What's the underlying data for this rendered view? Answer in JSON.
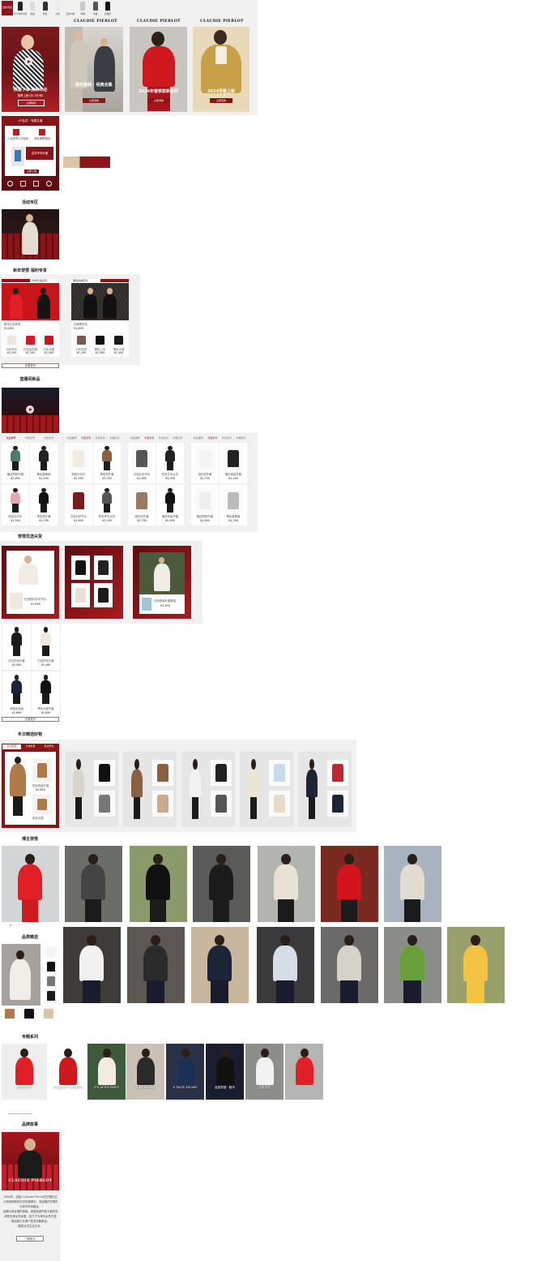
{
  "top_nav": {
    "items": [
      {
        "label": "活动专区",
        "active": true
      },
      {
        "label": "CP×传承大赛"
      },
      {
        "label": "新品"
      },
      {
        "label": "外套"
      },
      {
        "label": "大衣"
      },
      {
        "label": "卫衣/T恤"
      },
      {
        "label": "羊绒"
      },
      {
        "label": "半裙"
      },
      {
        "label": "直播间"
      }
    ]
  },
  "brand": {
    "logo": "CLAUDIE PIERLOT"
  },
  "hero_banners": [
    {
      "title": "快速下单 抢新年必",
      "subtitle": "春季上新1折 2件9折",
      "cta": "立即购买"
    },
    {
      "title": "新年焕新 · 经典合集",
      "cta": "立即选购"
    },
    {
      "title": "2024年春季款新系列",
      "cta": "立即选购"
    },
    {
      "title": "2024早春上新",
      "cta": "立即选购"
    }
  ],
  "member_card": {
    "header": "CP会员 · 专属礼遇",
    "perk1": "入会即享1次免邮",
    "perk2": "消费满额赠品",
    "perk3": "会员专享价格",
    "join": "立即入会",
    "icons": [
      "积分",
      "优惠",
      "礼品",
      "客服"
    ]
  },
  "sections": {
    "activity": "活动专区",
    "new_year": "新年穿搭 福利专享",
    "live": "直播间新品",
    "curated": "穿搭优选尖货",
    "knit": "冬日精选好物",
    "blogger": "博主穿搭",
    "offline": "品类精选",
    "collections": "专题系列",
    "story": "品牌故事"
  },
  "ny_cards": [
    {
      "label": "新年红色系列",
      "top": "新年红色穿搭",
      "price": "¥1,890"
    },
    {
      "label": "黑色丝绒系列",
      "top": "优雅黑色系",
      "price": "¥1,890"
    }
  ],
  "ny_products": [
    {
      "name": "针织开衫",
      "price": "¥1,290"
    },
    {
      "name": "红色连衣裙",
      "price": "¥2,190"
    },
    {
      "name": "红色半裙",
      "price": "¥1,490"
    },
    {
      "name": "针织毛衣",
      "price": "¥1,290"
    },
    {
      "name": "黑色上衣",
      "price": "¥1,590"
    },
    {
      "name": "黑色半裙",
      "price": "¥1,390"
    }
  ],
  "ny_more": "查看更多",
  "tab_groups": [
    {
      "tabs": [
        "新品推荐",
        "外套系列",
        "针织系列"
      ]
    },
    {
      "tabs": [
        "新品推荐",
        "外套系列",
        "针织系列",
        "半裙系列"
      ]
    },
    {
      "tabs": [
        "新品推荐",
        "外套系列",
        "针织系列",
        "半裙系列"
      ]
    },
    {
      "tabs": [
        "新品推荐",
        "外套系列",
        "针织系列",
        "半裙系列"
      ]
    }
  ],
  "grid_products": [
    {
      "name": "格纹短款外套",
      "price": "¥2,690"
    },
    {
      "name": "黑色直筒裤",
      "price": "¥1,290"
    },
    {
      "name": "粉色针织衫",
      "price": "¥1,590"
    },
    {
      "name": "黑色短外套",
      "price": "¥2,290"
    },
    {
      "name": "白色针织开衫",
      "price": "¥1,690"
    },
    {
      "name": "驼色羊毛大衣",
      "price": "¥3,290"
    },
    {
      "name": "酒红色外套",
      "price": "¥2,790"
    },
    {
      "name": "格纹西装外套",
      "price": "¥2,490"
    }
  ],
  "curated": {
    "card1": {
      "name": "红色纽扣针织开衫",
      "price": "¥1,890"
    },
    "card3": {
      "name": "白色西装外套套装",
      "price": "¥2,990"
    },
    "list": [
      {
        "name": "红白拼色外套",
        "price": "¥2,490"
      },
      {
        "name": "白色拼色外套",
        "price": "¥2,490"
      },
      {
        "name": "深蓝色西装",
        "price": "¥2,690"
      },
      {
        "name": "黑色长款外套",
        "price": "¥2,890"
      }
    ],
    "more": "查看更多"
  },
  "knit_tabs": [
    "针织套装",
    "大衣外套",
    "毛衣开衫"
  ],
  "knit_products": [
    {
      "name": "驼色西装外套",
      "price": "¥2,690"
    },
    {
      "name": "驼色半裙",
      "price": "¥1,290"
    }
  ],
  "collections": [
    "AFTER CP",
    "LE BALLET CLAUDIE",
    "IT'S AFTER PARTY",
    "A MONOWAY",
    "A TASTE ESCAPE",
    "品质穿搭 · 都市",
    "品质穿搭"
  ],
  "story": {
    "logo": "CLAUDIE PIERLOT",
    "lines": [
      "1984年，创始人Claudie Pierlot在巴黎创立同名品牌，",
      "以俏皮精致的法式风格闻名，将经典的巴黎风格",
      "与现代时尚融合。",
      "品牌以其优雅的剪裁、精致的细节和大胆的色彩",
      "深受全球女性喜爱，致力于为现代女性打造",
      "既经典又充满个性的衣橱单品，",
      "展现法式生活艺术。"
    ],
    "button": "了解更多"
  },
  "colors": {
    "brand_red": "#8a1418",
    "dark_red": "#5a0d10",
    "panel": "#f1f1f1"
  }
}
